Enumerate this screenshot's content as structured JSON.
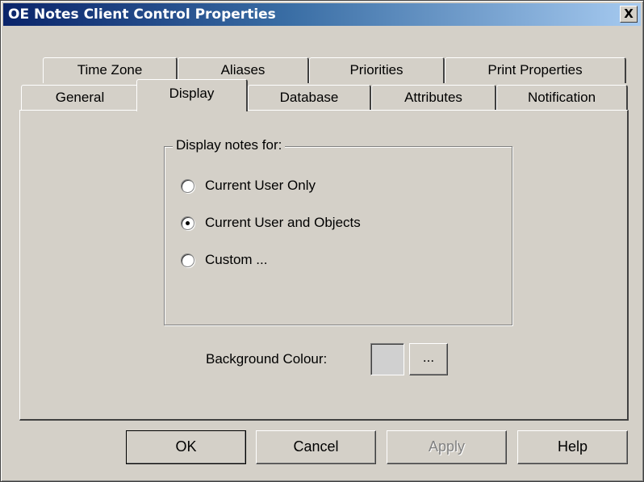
{
  "window": {
    "title": "OE Notes Client Control Properties",
    "close_label": "X"
  },
  "tabs": {
    "row_back": [
      {
        "label": "Time Zone"
      },
      {
        "label": "Aliases"
      },
      {
        "label": "Priorities"
      },
      {
        "label": "Print Properties"
      }
    ],
    "row_front": [
      {
        "label": "General"
      },
      {
        "label": "Display",
        "selected": true
      },
      {
        "label": "Database"
      },
      {
        "label": "Attributes"
      },
      {
        "label": "Notification"
      }
    ]
  },
  "display": {
    "group_label": "Display notes for:",
    "options": [
      {
        "label": "Current User Only",
        "checked": false
      },
      {
        "label": "Current User and Objects",
        "checked": true
      },
      {
        "label": "Custom ...",
        "checked": false
      }
    ],
    "background_colour_label": "Background Colour:",
    "background_colour_value": "#d0d0d0",
    "browse_label": "..."
  },
  "buttons": {
    "ok": "OK",
    "cancel": "Cancel",
    "apply": "Apply",
    "help": "Help"
  },
  "colors": {
    "title_start": "#0a246a",
    "title_end": "#a6caf0",
    "face": "#d4d0c8"
  },
  "icons": {
    "close": "close-icon"
  }
}
